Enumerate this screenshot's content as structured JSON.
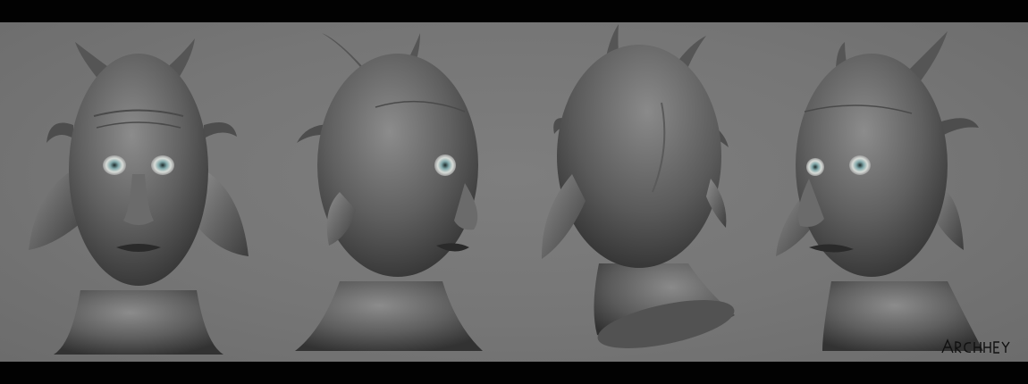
{
  "artwork": {
    "views": [
      "front",
      "three-quarter-right",
      "back",
      "three-quarter-left"
    ],
    "colors": {
      "letterbox": "#020202",
      "background": "#777777",
      "clay_light": "#8a8a8a",
      "clay_mid": "#5c5c5c",
      "clay_dark": "#3a3a3a",
      "eye_iris": "#7fa6a8"
    },
    "signature_text": "ARCHHEY"
  }
}
